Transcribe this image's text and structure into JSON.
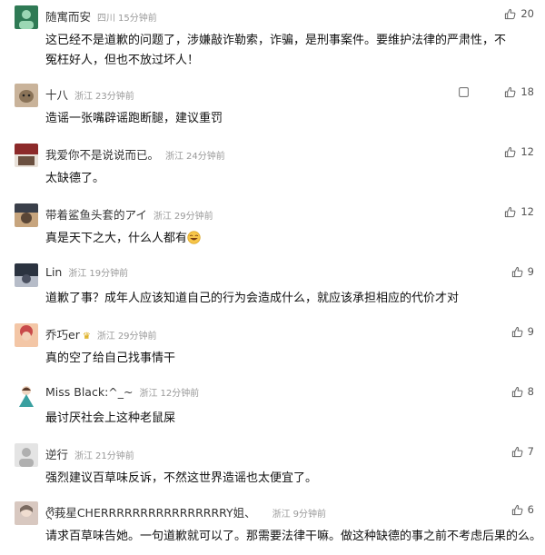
{
  "comments": [
    {
      "name": "随寓而安",
      "loc": "四川",
      "time": "15分钟前",
      "badge": "",
      "text": "这已经不是道歉的问题了，涉嫌敲诈勒索，诈骗，是刑事案件。要维护法律的严肃性，不冤枉好人，但也不放过坏人！",
      "likes": "20",
      "avatar_colors": [
        "#2f7a55",
        "#9bd7b4"
      ]
    },
    {
      "name": "十八",
      "loc": "浙江",
      "time": "23分钟前",
      "badge": "",
      "text": "造谣一张嘴辟谣跑断腿，建议重罚",
      "likes": "18",
      "avatar_colors": [
        "#c9b39a",
        "#8a7358"
      ]
    },
    {
      "name": "我爱你不是说说而已。",
      "loc": "浙江",
      "time": "24分钟前",
      "badge": "",
      "text": "太缺德了。",
      "likes": "12",
      "avatar_colors": [
        "#8c2a2a",
        "#e8e0d8"
      ]
    },
    {
      "name": "带着鲨鱼头套的アイ",
      "loc": "浙江",
      "time": "29分钟前",
      "badge": "",
      "text": "真是天下之大，什么人都有",
      "likes": "12",
      "avatar_colors": [
        "#3a3f4a",
        "#c7a57e"
      ]
    },
    {
      "name": "Lin",
      "loc": "浙江",
      "time": "19分钟前",
      "badge": "",
      "text": "道歉了事？成年人应该知道自己的行为会造成什么，就应该承担相应的代价才对",
      "likes": "9",
      "avatar_colors": [
        "#2b3340",
        "#b6bcc8"
      ]
    },
    {
      "name": "乔巧er",
      "loc": "浙江",
      "time": "29分钟前",
      "badge": "♛",
      "text": "真的空了给自己找事情干",
      "likes": "9",
      "avatar_colors": [
        "#c94a4a",
        "#f3c6a6"
      ]
    },
    {
      "name": "Miss Black:^_~",
      "loc": "浙江",
      "time": "12分钟前",
      "badge": "",
      "text": "最讨厌社会上这种老鼠屎",
      "likes": "8",
      "avatar_colors": [
        "#3aa0a0",
        "#f0d5c0"
      ]
    },
    {
      "name": "逆行",
      "loc": "浙江",
      "time": "21分钟前",
      "badge": "",
      "text": "强烈建议百草味反诉，不然这世界造谣也太便宜了。",
      "likes": "7",
      "avatar_colors": [
        "#e4e4e4",
        "#b0b0b0"
      ]
    },
    {
      "name": "ღ໊莪星CHERRRRRRRRRRRRRRRRY姐、",
      "loc": "浙江",
      "time": "9分钟前",
      "badge": "",
      "text": "请求百草味告她。一句道歉就可以了。那需要法律干嘛。做这种缺德的事之前不考虑后果的么。",
      "likes": "6",
      "avatar_colors": [
        "#d8c8c0",
        "#7a6a60"
      ]
    }
  ],
  "icons": {
    "like": "thumbs-up-icon",
    "more": "square-icon",
    "emoji": "grinning-emoji"
  }
}
